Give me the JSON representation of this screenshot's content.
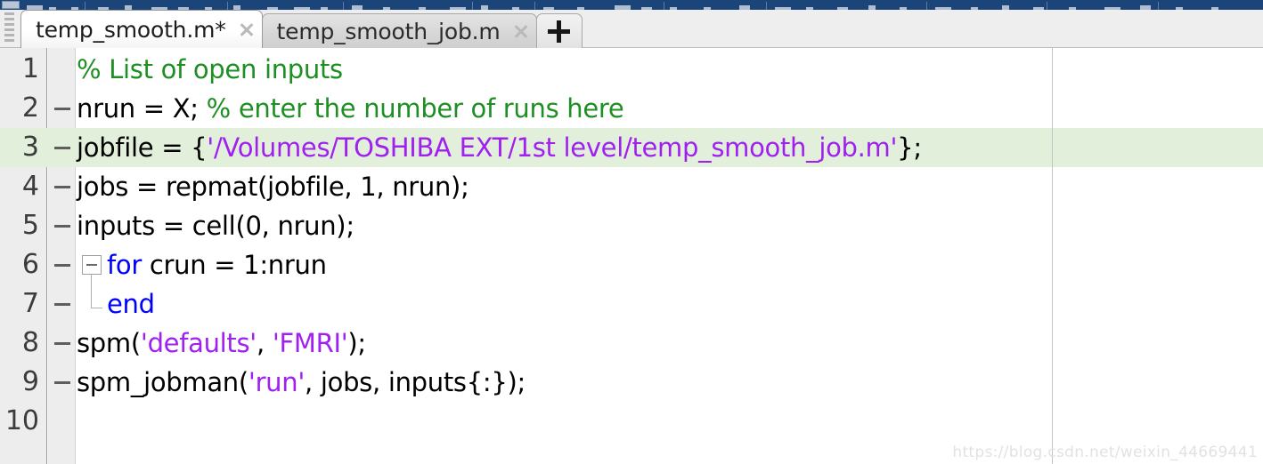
{
  "window": {
    "toolbar_strip_color": "#1b4479"
  },
  "tabbar": {
    "grip_name": "drag-grip",
    "tabs": [
      {
        "label": "temp_smooth.m*",
        "active": true,
        "close_label": "close-tab"
      },
      {
        "label": "temp_smooth_job.m",
        "active": false,
        "close_label": "close-tab"
      }
    ],
    "add_tab_label": "+"
  },
  "editor": {
    "current_line": 3,
    "highlight_color": "#e2efdb",
    "gutter_bg": "#ededed",
    "ruler_color": "#c4c4c4",
    "colors": {
      "comment": "#1d8f23",
      "string": "#a020f0",
      "keyword": "#0000ff",
      "plain": "#000000"
    },
    "lines": [
      {
        "number": "1",
        "marker": "",
        "tokens": [
          {
            "t": "% List of open inputs",
            "c": "comment"
          }
        ]
      },
      {
        "number": "2",
        "marker": "-",
        "tokens": [
          {
            "t": "nrun = X; ",
            "c": "plain"
          },
          {
            "t": "% enter the number of runs here",
            "c": "comment"
          }
        ]
      },
      {
        "number": "3",
        "marker": "-",
        "tokens": [
          {
            "t": "jobfile = {",
            "c": "plain"
          },
          {
            "t": "'/Volumes/TOSHIBA EXT/1st level/temp_smooth_job.m'",
            "c": "string"
          },
          {
            "t": "};",
            "c": "plain"
          }
        ]
      },
      {
        "number": "4",
        "marker": "-",
        "tokens": [
          {
            "t": "jobs = repmat(jobfile, 1, nrun);",
            "c": "plain"
          }
        ]
      },
      {
        "number": "5",
        "marker": "-",
        "tokens": [
          {
            "t": "inputs = cell(0, nrun);",
            "c": "plain"
          }
        ]
      },
      {
        "number": "6",
        "marker": "-",
        "fold": "open",
        "tokens": [
          {
            "t": "for",
            "c": "keyword"
          },
          {
            "t": " crun = 1:nrun",
            "c": "plain"
          }
        ]
      },
      {
        "number": "7",
        "marker": "-",
        "fold": "end",
        "tokens": [
          {
            "t": "end",
            "c": "keyword"
          }
        ]
      },
      {
        "number": "8",
        "marker": "-",
        "tokens": [
          {
            "t": "spm(",
            "c": "plain"
          },
          {
            "t": "'defaults'",
            "c": "string"
          },
          {
            "t": ", ",
            "c": "plain"
          },
          {
            "t": "'FMRI'",
            "c": "string"
          },
          {
            "t": ");",
            "c": "plain"
          }
        ]
      },
      {
        "number": "9",
        "marker": "-",
        "tokens": [
          {
            "t": "spm_jobman(",
            "c": "plain"
          },
          {
            "t": "'run'",
            "c": "string"
          },
          {
            "t": ", jobs, inputs{:});",
            "c": "plain"
          }
        ]
      },
      {
        "number": "10",
        "marker": "",
        "tokens": []
      }
    ]
  },
  "watermark": {
    "text": "https://blog.csdn.net/weixin_44669441"
  }
}
